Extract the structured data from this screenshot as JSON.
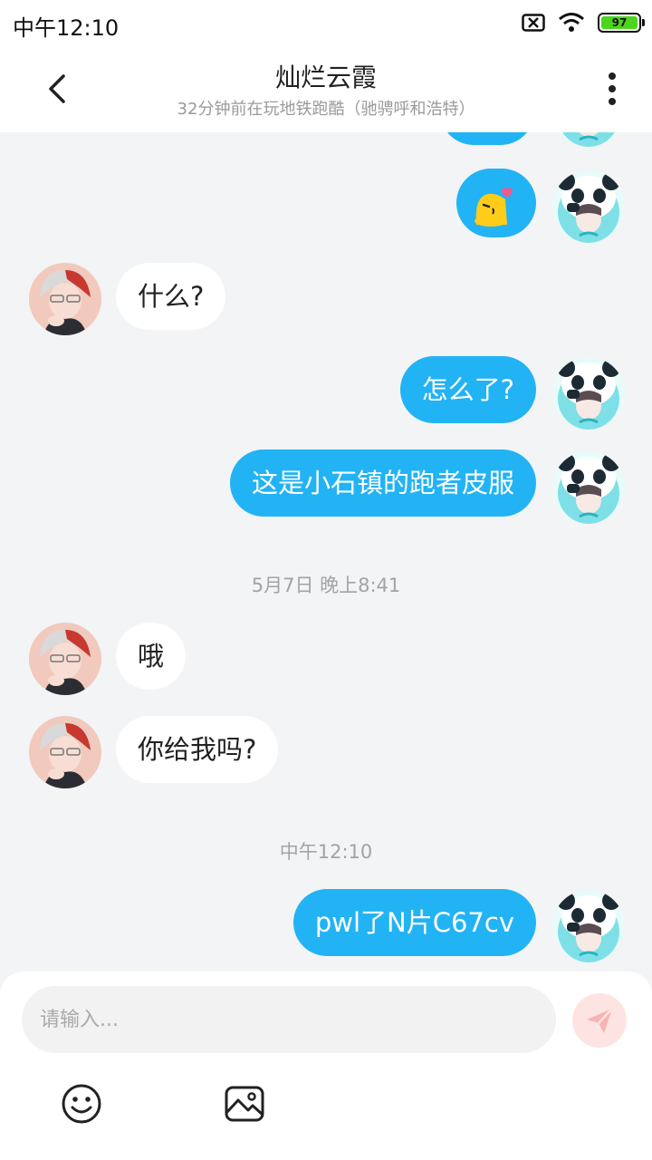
{
  "status_bar": {
    "time": "中午12:10",
    "battery": "97"
  },
  "header": {
    "title": "灿烂云霞",
    "subtitle": "32分钟前在玩地铁跑酷（驰骋呼和浩特）"
  },
  "messages": [
    {
      "side": "out",
      "kind": "emoji",
      "icon": "kiss-emoji"
    },
    {
      "side": "in",
      "text": "什么?"
    },
    {
      "side": "out",
      "text": "怎么了?"
    },
    {
      "side": "out",
      "text": "这是小石镇的跑者皮服"
    },
    {
      "kind": "timestamp",
      "text": "5月7日 晚上8:41"
    },
    {
      "side": "in",
      "text": "哦"
    },
    {
      "side": "in",
      "text": "你给我吗?"
    },
    {
      "kind": "timestamp",
      "text": "中午12:10"
    },
    {
      "side": "out",
      "text": "pwl了N片C67cv"
    }
  ],
  "composer": {
    "placeholder": "请输入...",
    "tools": [
      "smiley-icon",
      "image-icon"
    ],
    "send_icon": "send-icon"
  },
  "colors": {
    "outgoing_bubble": "#22b3f5",
    "incoming_bubble": "#ffffff",
    "background": "#f3f4f6",
    "send_button": "#fde4e3"
  }
}
